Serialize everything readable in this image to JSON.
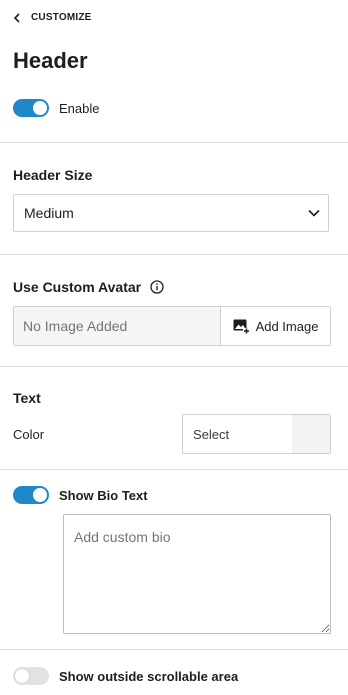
{
  "nav": {
    "back_label": "CUSTOMIZE"
  },
  "panel": {
    "title": "Header"
  },
  "enable": {
    "label": "Enable",
    "on": true
  },
  "header_size": {
    "label": "Header Size",
    "selected": "Medium"
  },
  "custom_avatar": {
    "label": "Use Custom Avatar",
    "placeholder": "No Image Added",
    "button_label": "Add Image"
  },
  "text": {
    "section_label": "Text",
    "color_label": "Color",
    "color_select": "Select"
  },
  "bio": {
    "toggle_label": "Show Bio Text",
    "on": true,
    "placeholder": "Add custom bio"
  },
  "scrollable": {
    "label": "Show outside scrollable area",
    "on": false
  },
  "colors": {
    "accent": "#1e88c9",
    "toggle_off": "#e2e2e2",
    "divider": "#e2e2e2"
  }
}
